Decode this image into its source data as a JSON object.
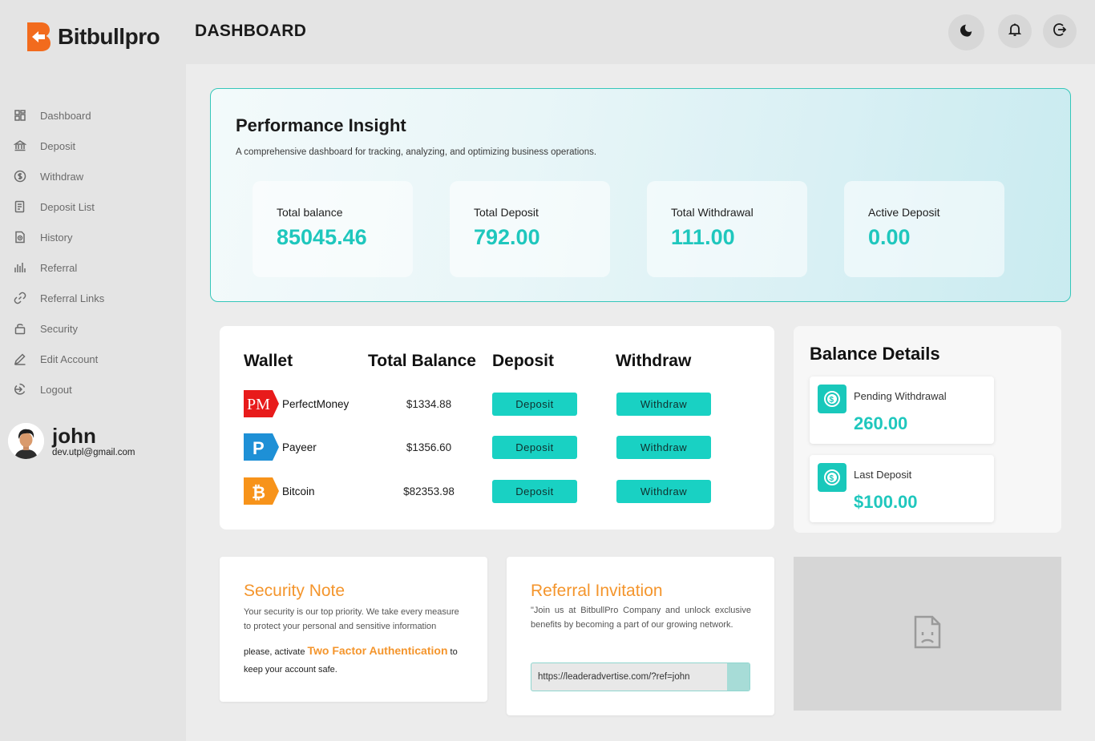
{
  "brand": {
    "name": "Bitbullpro",
    "accent": "#f26b1d",
    "teal": "#19d1c3"
  },
  "sidebar": {
    "items": [
      {
        "label": "Dashboard",
        "icon": "grid-icon"
      },
      {
        "label": "Deposit",
        "icon": "bank-icon"
      },
      {
        "label": "Withdraw",
        "icon": "dollar-circle-icon"
      },
      {
        "label": "Deposit List",
        "icon": "list-icon"
      },
      {
        "label": "History",
        "icon": "document-clock-icon"
      },
      {
        "label": "Referral",
        "icon": "bar-chart-icon"
      },
      {
        "label": "Referral Links",
        "icon": "link-icon"
      },
      {
        "label": "Security",
        "icon": "lock-icon"
      },
      {
        "label": "Edit Account",
        "icon": "pencil-icon"
      },
      {
        "label": "Logout",
        "icon": "logout-icon"
      }
    ]
  },
  "user": {
    "name": "john",
    "email": "dev.utpl@gmail.com"
  },
  "header": {
    "title": "DASHBOARD"
  },
  "insight": {
    "title": "Performance Insight",
    "subtitle": "A comprehensive dashboard for tracking, analyzing, and optimizing business operations.",
    "stats": [
      {
        "label": "Total balance",
        "value": "85045.46"
      },
      {
        "label": "Total Deposit",
        "value": "792.00"
      },
      {
        "label": "Total Withdrawal",
        "value": "111.00"
      },
      {
        "label": "Active Deposit",
        "value": "0.00"
      }
    ]
  },
  "wallet": {
    "headers": [
      "Wallet",
      "Total Balance",
      "Deposit",
      "Withdraw"
    ],
    "deposit_label": "Deposit",
    "withdraw_label": "Withdraw",
    "rows": [
      {
        "name": "PerfectMoney",
        "balance": "$1334.88",
        "logo_text": "PM"
      },
      {
        "name": "Payeer",
        "balance": "$1356.60",
        "logo_text": "P"
      },
      {
        "name": "Bitcoin",
        "balance": "$82353.98",
        "logo_text": "₿"
      }
    ]
  },
  "balance_details": {
    "title": "Balance Details",
    "items": [
      {
        "label": "Pending Withdrawal",
        "value": "260.00"
      },
      {
        "label": "Last Deposit",
        "value": "$100.00"
      }
    ]
  },
  "security_note": {
    "title": "Security Note",
    "text": "Your security is our top priority. We take every measure to protect your personal and sensitive information",
    "prefix": "please, activate ",
    "link": "Two Factor Authentication",
    "suffix": " to keep your account safe."
  },
  "referral": {
    "title": "Referral Invitation",
    "text": "\"Join us at BitbullPro Company and unlock exclusive benefits by becoming a part of our growing network.",
    "link": "https://leaderadvertise.com/?ref=john"
  }
}
